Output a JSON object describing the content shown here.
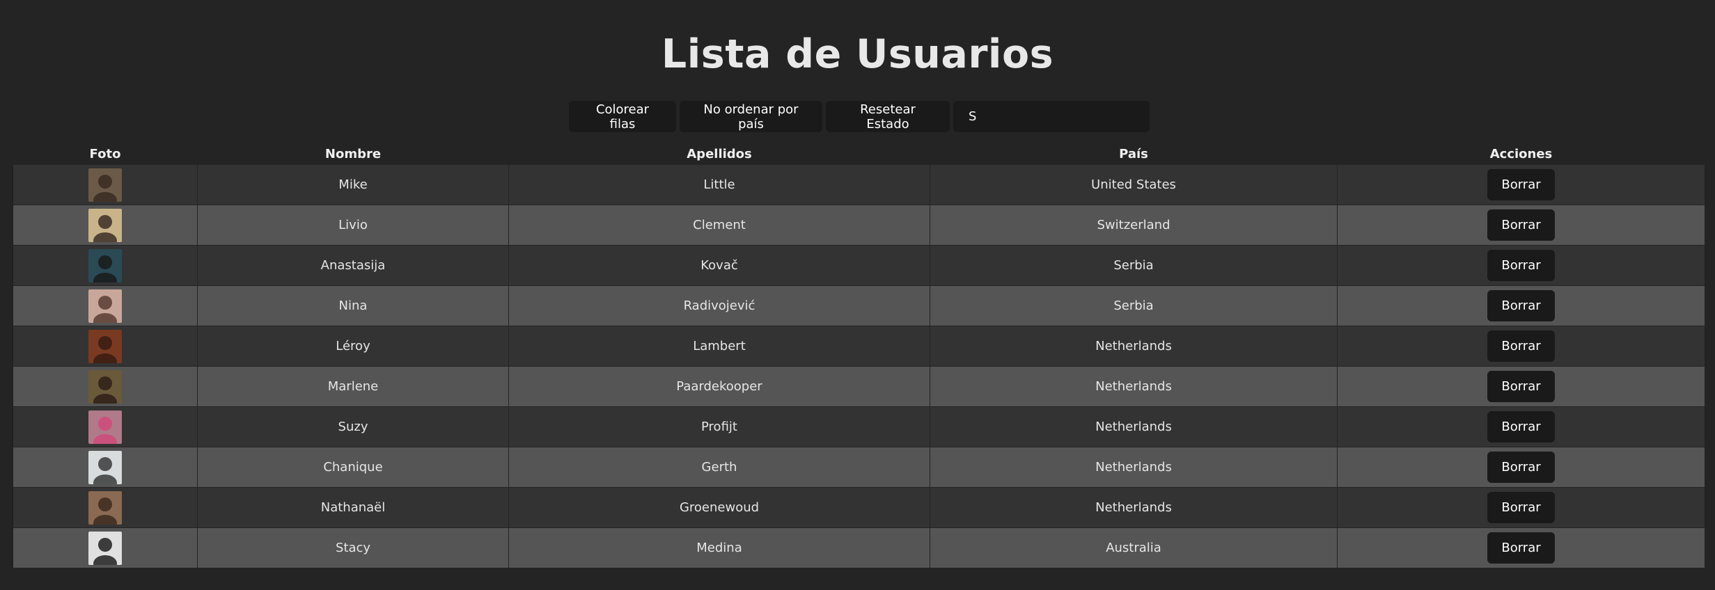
{
  "title": "Lista de Usuarios",
  "toolbar": {
    "color_rows_label": "Colorear filas",
    "sort_country_label": "No ordenar por país",
    "reset_label": "Resetear Estado",
    "filter_value": "S"
  },
  "table": {
    "headers": {
      "photo": "Foto",
      "name": "Nombre",
      "surname": "Apellidos",
      "country": "País",
      "actions": "Acciones"
    },
    "delete_label": "Borrar",
    "rows": [
      {
        "name": "Mike",
        "surname": "Little",
        "country": "United States",
        "avatar": "user-photo-icon"
      },
      {
        "name": "Livio",
        "surname": "Clement",
        "country": "Switzerland",
        "avatar": "user-photo-icon"
      },
      {
        "name": "Anastasija",
        "surname": "Kovač",
        "country": "Serbia",
        "avatar": "user-photo-icon"
      },
      {
        "name": "Nina",
        "surname": "Radivojević",
        "country": "Serbia",
        "avatar": "user-photo-icon"
      },
      {
        "name": "Léroy",
        "surname": "Lambert",
        "country": "Netherlands",
        "avatar": "user-photo-icon"
      },
      {
        "name": "Marlene",
        "surname": "Paardekooper",
        "country": "Netherlands",
        "avatar": "user-photo-icon"
      },
      {
        "name": "Suzy",
        "surname": "Profijt",
        "country": "Netherlands",
        "avatar": "user-photo-icon"
      },
      {
        "name": "Chanique",
        "surname": "Gerth",
        "country": "Netherlands",
        "avatar": "user-photo-icon"
      },
      {
        "name": "Nathanaël",
        "surname": "Groenewoud",
        "country": "Netherlands",
        "avatar": "user-photo-icon"
      },
      {
        "name": "Stacy",
        "surname": "Medina",
        "country": "Australia",
        "avatar": "user-photo-icon"
      }
    ]
  },
  "colors": {
    "background": "#242424",
    "row_odd": "#333333",
    "row_even": "#555555",
    "button": "#1a1a1a"
  }
}
